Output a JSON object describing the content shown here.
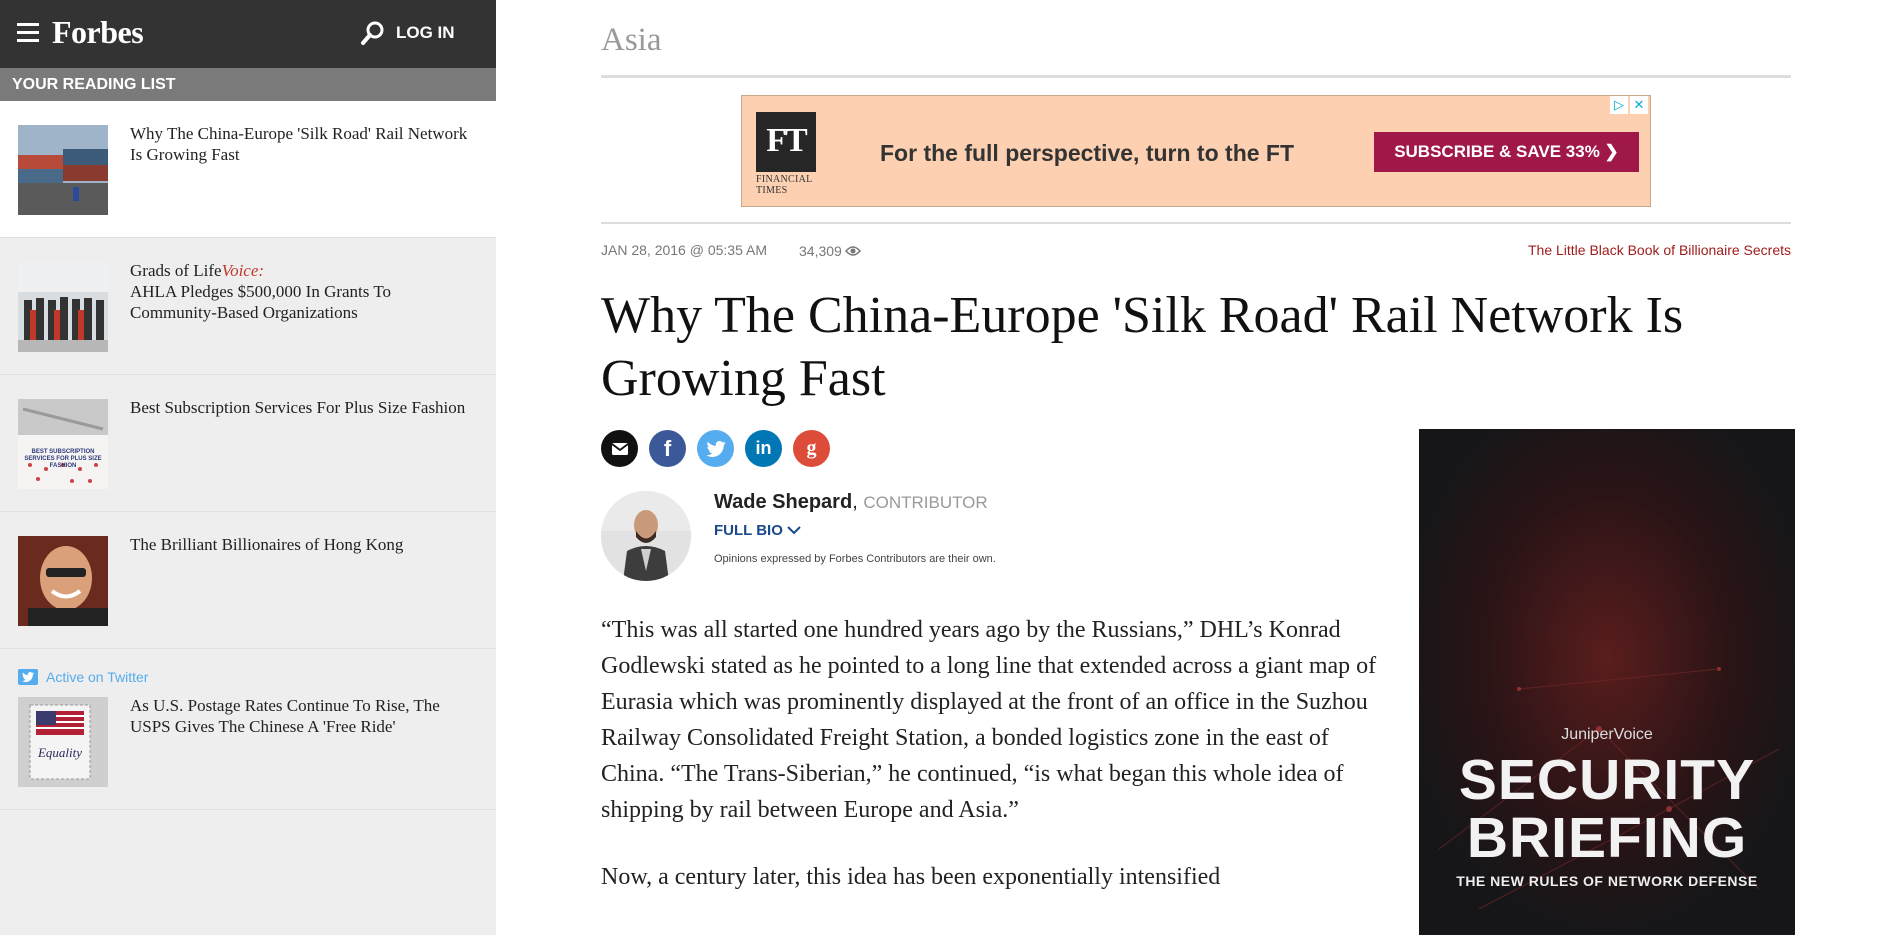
{
  "header": {
    "logo": "Forbes",
    "login_label": "LOG IN"
  },
  "reading_list": {
    "title": "YOUR READING LIST",
    "items": [
      {
        "title": "Why The China-Europe 'Silk Road' Rail Network Is Growing Fast"
      },
      {
        "prefix": "Grads of Life",
        "voice": "Voice:",
        "title": "AHLA Pledges $500,000 In Grants To Community-Based Organizations"
      },
      {
        "title": "Best Subscription Services For Plus Size Fashion",
        "thumb_text": "BEST SUBSCRIPTION SERVICES FOR PLUS SIZE FASHION"
      },
      {
        "title": "The Brilliant Billionaires of Hong Kong"
      },
      {
        "badge": "Active on Twitter",
        "title": "As U.S. Postage Rates Continue To Rise, The USPS Gives The Chinese A 'Free Ride'",
        "thumb_text": "Equality"
      }
    ]
  },
  "article": {
    "section": "Asia",
    "date": "JAN 28, 2016 @ 05:35 AM",
    "views": "34,309",
    "promo_link": "The Little Black Book of Billionaire Secrets",
    "headline": "Why The China-Europe 'Silk Road' Rail Network Is Growing Fast",
    "author": {
      "name": "Wade Shepard",
      "role": "CONTRIBUTOR",
      "full_bio": "FULL BIO",
      "disclaimer": "Opinions expressed by Forbes Contributors are their own."
    },
    "paragraphs": [
      "“This was all started one hundred years ago by the Russians,” DHL’s Konrad Godlewski stated as he pointed to a long line that extended across a giant map of Eurasia which was prominently displayed at the front of an office in the Suzhou Railway Consolidated Freight Station, a bonded logistics zone in the east of China. “The Trans-Siberian,” he continued, “is what began this whole idea of shipping by rail between Europe and Asia.”",
      "Now, a century later, this idea has been exponentially intensified"
    ]
  },
  "top_ad": {
    "logo": "FT",
    "logo_sub": "FINANCIAL TIMES",
    "text": "For the full perspective, turn to the FT",
    "cta": "SUBSCRIBE & SAVE 33%  ❯"
  },
  "side_ad": {
    "brand": "JuniperVoice",
    "headline_1": "SECURITY",
    "headline_2": "BRIEFING",
    "subline": "THE NEW RULES OF NETWORK DEFENSE"
  },
  "share": [
    "email-icon",
    "facebook-icon",
    "twitter-icon",
    "linkedin-icon",
    "google-plus-icon"
  ],
  "colors": {
    "topbar": "#333333",
    "reading_header": "#7a7a7a",
    "promo_red": "#a01d1d",
    "ft_cta": "#a0174a",
    "ft_bg": "#fcd0b1",
    "facebook": "#3b5998",
    "twitter": "#55acee",
    "linkedin": "#0077b5",
    "google": "#dd4b39"
  }
}
